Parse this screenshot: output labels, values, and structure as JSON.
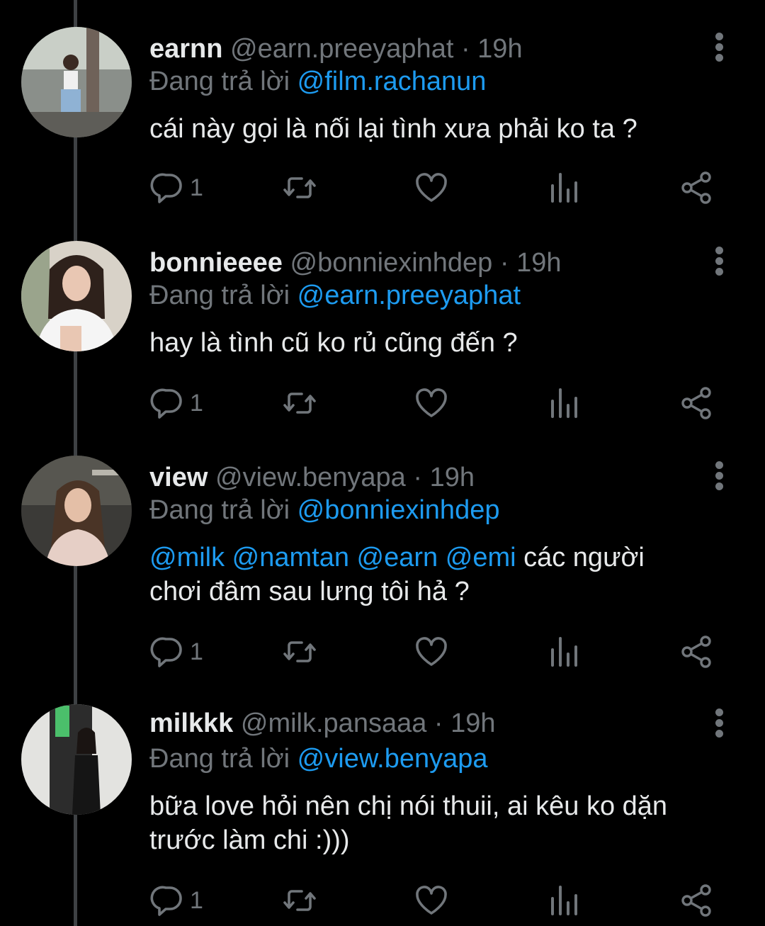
{
  "tweets": [
    {
      "name": "earnn",
      "handle": "@earn.preeyaphat",
      "time": "19h",
      "reply_prefix": "Đang trả lời",
      "reply_to": "@film.rachanun",
      "mentions": "",
      "text": "cái này gọi là nối lại tình xưa phải ko ta ?",
      "reply_count": "1"
    },
    {
      "name": "bonnieeee",
      "handle": "@bonniexinhdep",
      "time": "19h",
      "reply_prefix": "Đang trả lời",
      "reply_to": "@earn.preeyaphat",
      "mentions": "",
      "text": "hay là tình cũ ko rủ cũng đến ?",
      "reply_count": "1"
    },
    {
      "name": "view",
      "handle": "@view.benyapa",
      "time": "19h",
      "reply_prefix": "Đang trả lời",
      "reply_to": "@bonniexinhdep",
      "mentions": "@milk @namtan @earn @emi",
      "text": " các người chơi đâm sau lưng tôi hả ?",
      "reply_count": "1"
    },
    {
      "name": "milkkk",
      "handle": "@milk.pansaaa",
      "time": "19h",
      "reply_prefix": "Đang trả lời",
      "reply_to": "@view.benyapa",
      "mentions": "",
      "text": "bữa love hỏi nên chị nói thuii, ai kêu ko dặn trước làm chi :)))",
      "reply_count": "1"
    }
  ],
  "separator": "·",
  "icons": [
    "reply-icon",
    "retweet-icon",
    "like-icon",
    "views-icon",
    "share-icon",
    "more-icon"
  ],
  "colors": {
    "background": "#000000",
    "text": "#e7e9ea",
    "muted": "#71767b",
    "link": "#1d9bf0",
    "thread_line": "#3e4144"
  }
}
